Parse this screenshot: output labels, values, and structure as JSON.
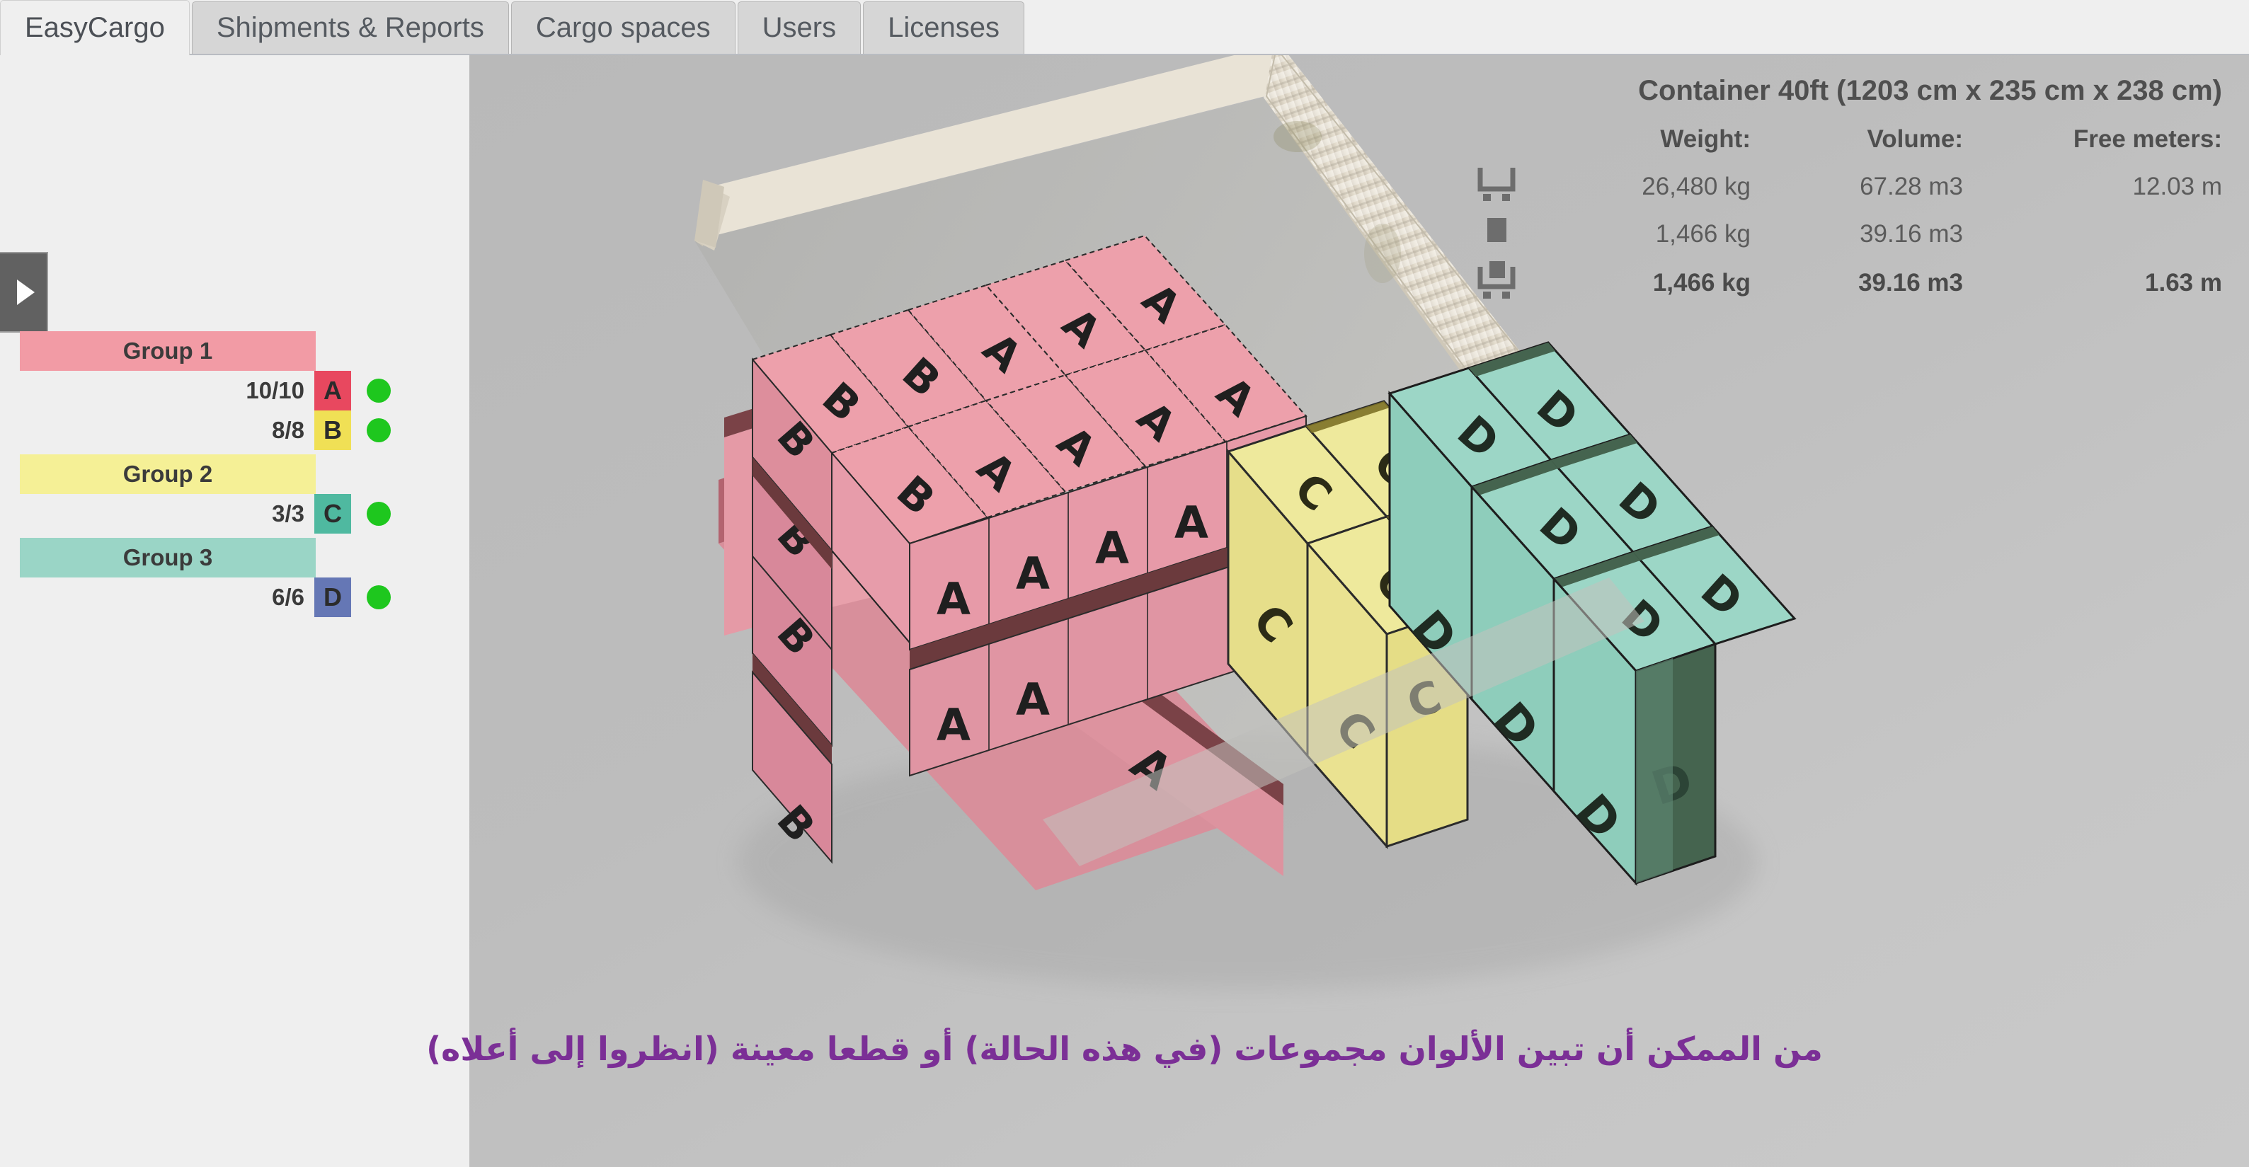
{
  "tabs": [
    {
      "label": "EasyCargo",
      "active": true
    },
    {
      "label": "Shipments & Reports",
      "active": false
    },
    {
      "label": "Cargo spaces",
      "active": false
    },
    {
      "label": "Users",
      "active": false
    },
    {
      "label": "Licenses",
      "active": false
    }
  ],
  "sidebar": {
    "toggle_icon": "triangle-right-icon",
    "groups": [
      {
        "label": "Group 1",
        "color": "#f29ba5",
        "items": [
          {
            "count": "10/10",
            "code": "A",
            "color": "#e8485f",
            "status_color": "#1ec71e"
          },
          {
            "count": "8/8",
            "code": "B",
            "color": "#f0e055",
            "status_color": "#1ec71e"
          }
        ]
      },
      {
        "label": "Group 2",
        "color": "#f5f096",
        "items": [
          {
            "count": "3/3",
            "code": "C",
            "color": "#4fb9a0",
            "status_color": "#1ec71e"
          }
        ]
      },
      {
        "label": "Group 3",
        "color": "#9ad5c6",
        "items": [
          {
            "count": "6/6",
            "code": "D",
            "color": "#6577b5",
            "status_color": "#1ec71e"
          }
        ]
      }
    ]
  },
  "info": {
    "title": "Container 40ft (1203 cm x 235 cm x 238 cm)",
    "headers": {
      "weight": "Weight:",
      "volume": "Volume:",
      "free": "Free meters:"
    },
    "rows": [
      {
        "icon": "empty-container-icon",
        "weight": "26,480 kg",
        "volume": "67.28 m3",
        "free": "12.03 m",
        "bold": false
      },
      {
        "icon": "cargo-box-icon",
        "weight": "1,466 kg",
        "volume": "39.16 m3",
        "free": "",
        "bold": false
      },
      {
        "icon": "loaded-container-icon",
        "weight": "1,466 kg",
        "volume": "39.16 m3",
        "free": "1.63 m",
        "bold": true
      }
    ]
  },
  "scene": {
    "container_label": "40ft shipping container 3d view",
    "cargo_letters": [
      "A",
      "B",
      "C",
      "D"
    ],
    "colors": {
      "pink_top": "#eda0ab",
      "pink_side": "#e48f9c",
      "pink_dark": "#6b3a3d",
      "yellow_top": "#efe89b",
      "yellow_side": "#e8e08c",
      "yellow_dark": "#7d7227",
      "teal_top": "#9cd6c6",
      "teal_side": "#8ecdbb",
      "teal_dark": "#45644f",
      "container_wall": "#e3ded2",
      "container_floor": "#bdbdb8",
      "letter": "#1f2b22"
    }
  },
  "caption": {
    "text": "من الممكن أن تبين الألوان مجموعات (في هذه الحالة) أو قطعا معينة (انظروا إلى أعلاه)",
    "color": "#7b2f96"
  }
}
